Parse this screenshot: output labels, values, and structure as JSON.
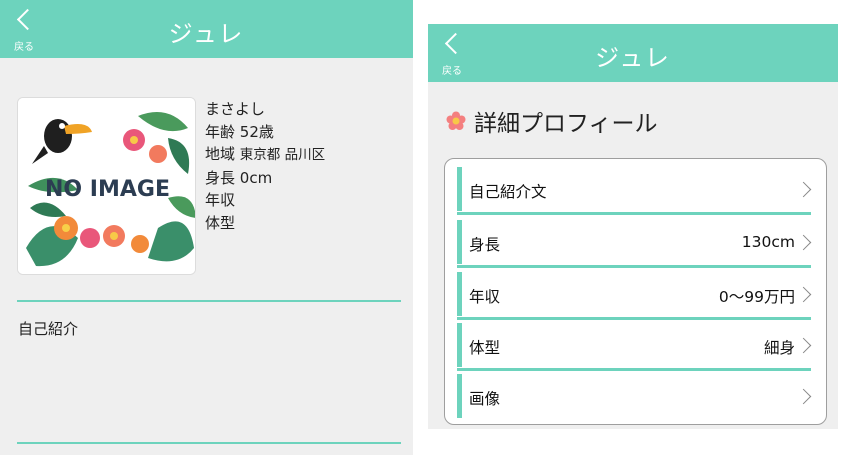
{
  "colors": {
    "accent": "#6dd3bd",
    "panel_bg": "#efefef"
  },
  "left_screen": {
    "header": {
      "back_label": "戻る",
      "title": "ジュレ"
    },
    "profile": {
      "photo_text": "NO IMAGE",
      "name": "まさよし",
      "age_label": "年齢",
      "age_value": "52歳",
      "region_label": "地域",
      "region_value": "東京都 品川区",
      "height_label": "身長",
      "height_value": "0cm",
      "income_label": "年収",
      "body_label": "体型"
    },
    "self_intro_label": "自己紹介"
  },
  "right_screen": {
    "header": {
      "back_label": "戻る",
      "title": "ジュレ"
    },
    "section_title": "詳細プロフィール",
    "items": [
      {
        "label": "自己紹介文",
        "value": ""
      },
      {
        "label": "身長",
        "value": "130cm"
      },
      {
        "label": "年収",
        "value": "0〜99万円"
      },
      {
        "label": "体型",
        "value": "細身"
      },
      {
        "label": "画像",
        "value": ""
      }
    ],
    "icons": {
      "section": "flower-icon",
      "row_arrow": "chevron-right-icon",
      "back": "chevron-left-icon"
    }
  }
}
